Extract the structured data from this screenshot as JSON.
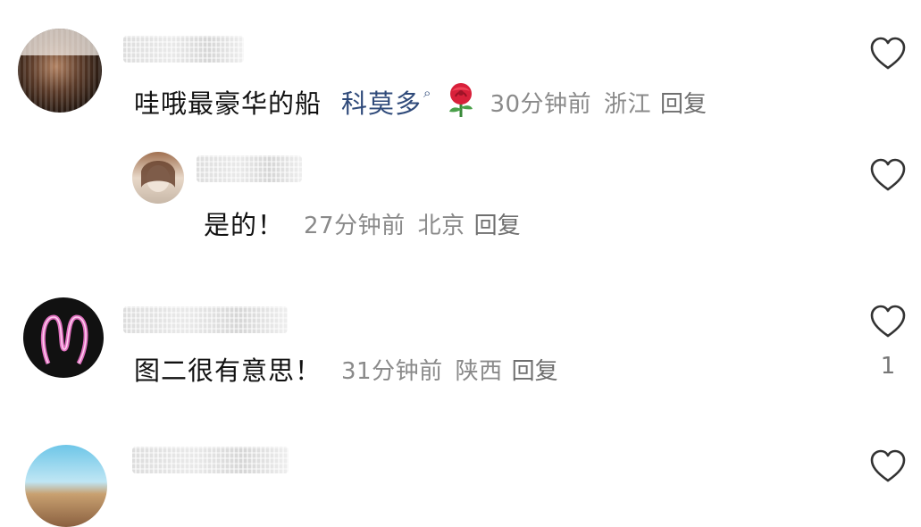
{
  "comments": [
    {
      "text": "哇哦最豪华的船",
      "mention": "科莫多",
      "mention_suffix": "⌕",
      "time": "30分钟前",
      "location": "浙江",
      "reply_label": "回复",
      "like_count": ""
    },
    {
      "text": "是的！",
      "time": "27分钟前",
      "location": "北京",
      "reply_label": "回复",
      "like_count": ""
    },
    {
      "text": "图二很有意思！",
      "time": "31分钟前",
      "location": "陕西",
      "reply_label": "回复",
      "like_count": "1"
    },
    {
      "text": "",
      "time": "",
      "location": "",
      "reply_label": "",
      "like_count": ""
    }
  ],
  "icons": {
    "like": "heart-outline-icon",
    "rose": "rose-emoji-icon"
  },
  "colors": {
    "mention": "#2f4a7a",
    "meta": "#8a8a8a",
    "heart_stroke": "#333333"
  }
}
